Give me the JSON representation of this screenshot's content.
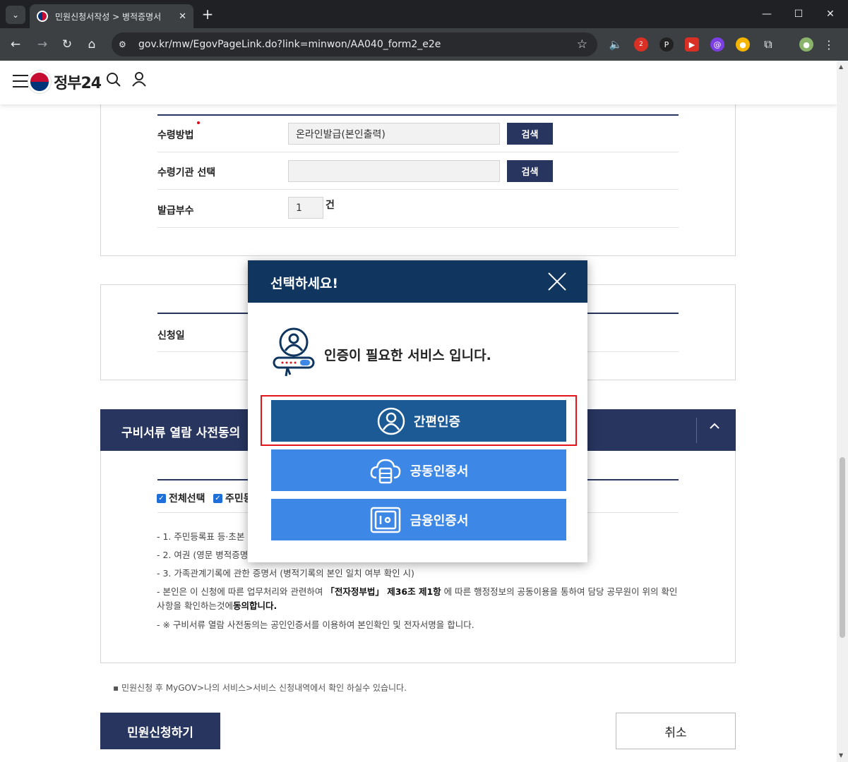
{
  "browser": {
    "tab_title": "민원신청서작성 > 병적증명서",
    "url": "gov.kr/mw/EgovPageLink.do?link=minwon/AA040_form2_e2e",
    "ext_badge": "2"
  },
  "header": {
    "logo_text": "정부24"
  },
  "form": {
    "receive_method": {
      "label": "수령방법",
      "value": "온라인발급(본인출력)",
      "button": "검색"
    },
    "receive_office": {
      "label": "수령기관 선택",
      "value": "",
      "button": "검색"
    },
    "copies": {
      "label": "발급부수",
      "value": "1",
      "unit": "건"
    },
    "apply_date": {
      "label": "신청일"
    }
  },
  "consent": {
    "title": "구비서류 열람 사전동의",
    "select_all": "전체선택",
    "select_resident": "주민등",
    "notes": [
      "- 1. 주민등록표 등·초본",
      "- 2. 여권 (영문 병적증명서",
      "- 3. 가족관계기록에 관한 증명서 (병적기록의 본인 일치 여부 확인 시)",
      "- 본인은 이 신청에 따른 업무처리와 관련하여",
      "「전자정부법」 제36조 제1항",
      "에 따른 행정정보의 공동이용을 통하여 담당 공무원이 위의 확인 사",
      "항을 확인하는것에",
      "동의합니다.",
      "- ※ 구비서류 열람 사전동의는 공인인증서를 이용하여 본인확인 및 전자서명을 합니다."
    ]
  },
  "footnote": "민원신청 후 MyGOV>나의 서비스>서비스 신청내역에서 확인 하실수 있습니다.",
  "actions": {
    "apply": "민원신청하기",
    "cancel": "취소"
  },
  "modal": {
    "title": "선택하세요!",
    "message": "인증이 필요한 서비스 입니다.",
    "options": [
      {
        "label": "간편인증",
        "color": "#1c5a96"
      },
      {
        "label": "공동인증서",
        "color": "#3d87e6"
      },
      {
        "label": "금융인증서",
        "color": "#3d87e6"
      }
    ]
  }
}
